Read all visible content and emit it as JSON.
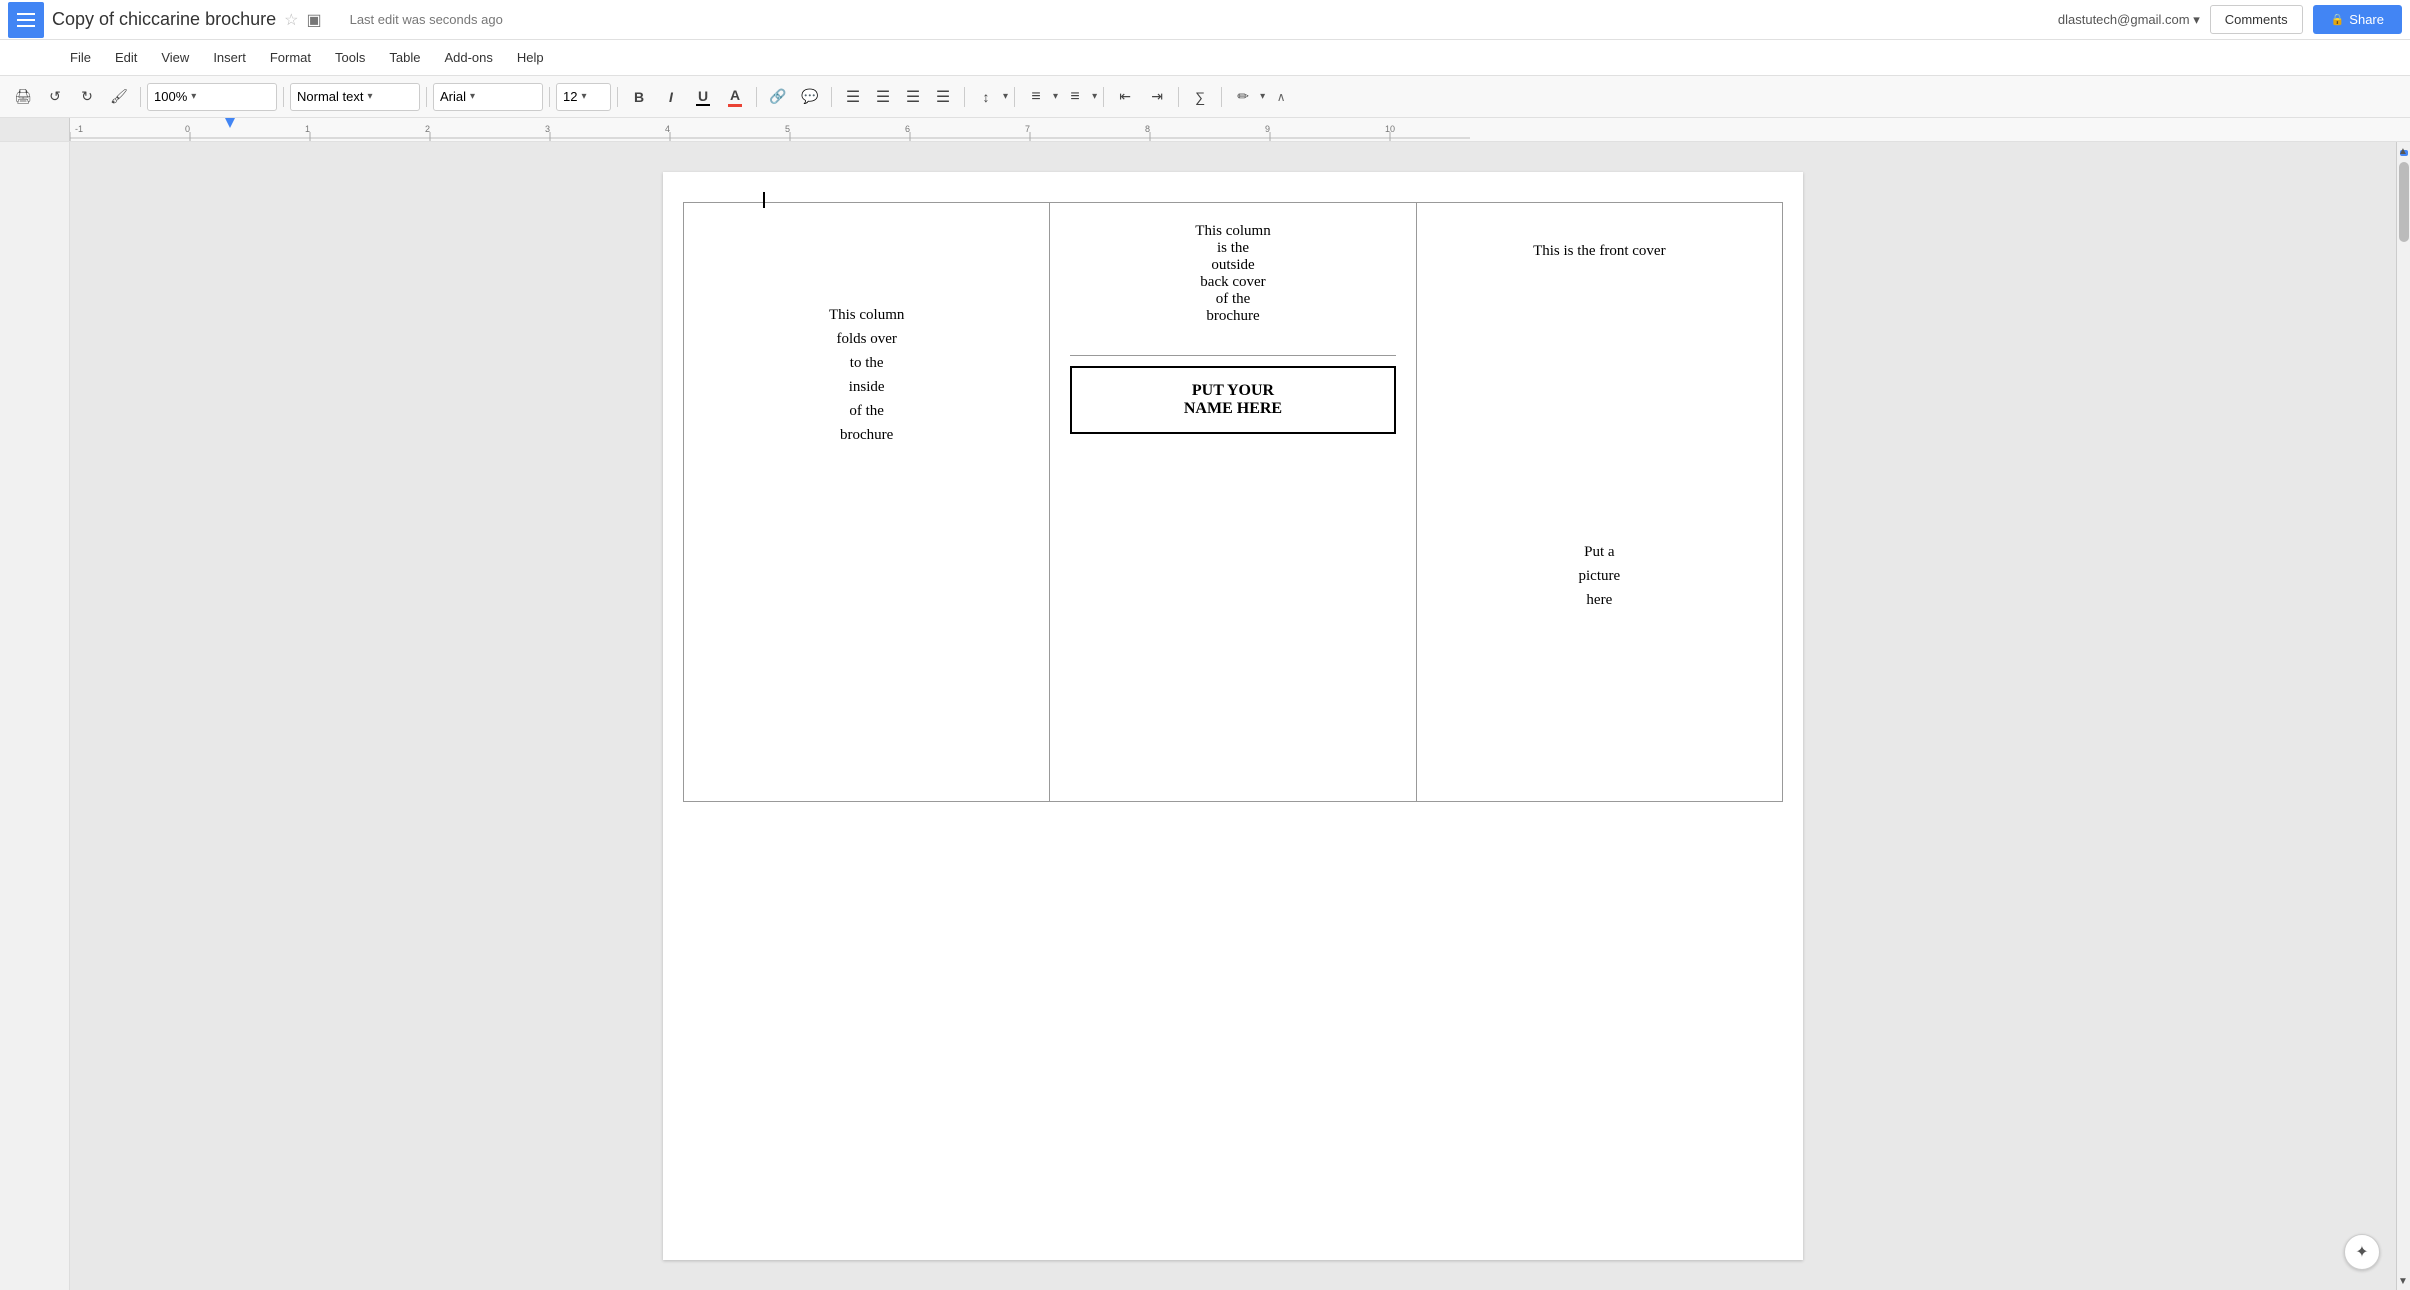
{
  "app": {
    "menu_icon": "☰",
    "title": "Copy of chiccarine brochure",
    "star_icon": "☆",
    "folder_icon": "▣",
    "save_status": "Last edit was seconds ago",
    "user_email": "dlastutech@gmail.com",
    "user_chevron": "▾",
    "comments_label": "Comments",
    "share_label": "Share",
    "lock_icon": "🔒"
  },
  "menu": {
    "items": [
      "File",
      "Edit",
      "View",
      "Insert",
      "Format",
      "Tools",
      "Table",
      "Add-ons",
      "Help"
    ]
  },
  "toolbar": {
    "print_icon": "🖨",
    "undo_icon": "↺",
    "redo_icon": "↻",
    "paint_icon": "🖌",
    "zoom_value": "100%",
    "zoom_chevron": "▾",
    "style_value": "Normal text",
    "style_chevron": "▾",
    "font_value": "Arial",
    "font_chevron": "▾",
    "size_value": "12",
    "size_chevron": "▾",
    "bold_label": "B",
    "italic_label": "I",
    "underline_label": "U",
    "link_icon": "🔗",
    "comment_icon": "💬",
    "align_left": "≡",
    "align_center": "≡",
    "align_right": "≡",
    "align_justify": "≡",
    "line_spacing": "↕",
    "list_numbered": "≡",
    "list_bullet": "≡",
    "indent_less": "⇤",
    "indent_more": "⇥",
    "formula_icon": "∑",
    "pen_icon": "✏",
    "collapse_icon": "∧"
  },
  "document": {
    "column_left_text": "This column\nfolds over\nto the\ninside\nof the\nbrochure",
    "column_middle_text": "This column\nis the\noutside\nback cover\nof the\nbrochure",
    "name_box_text": "PUT YOUR\nNAME HERE",
    "column_right_text": "This is the front cover",
    "picture_placeholder": "Put a\npicture\nhere"
  },
  "ruler": {
    "ticks": [
      "-1",
      "0",
      "1",
      "2",
      "3",
      "4",
      "5",
      "6",
      "7",
      "8",
      "9",
      "10"
    ]
  }
}
